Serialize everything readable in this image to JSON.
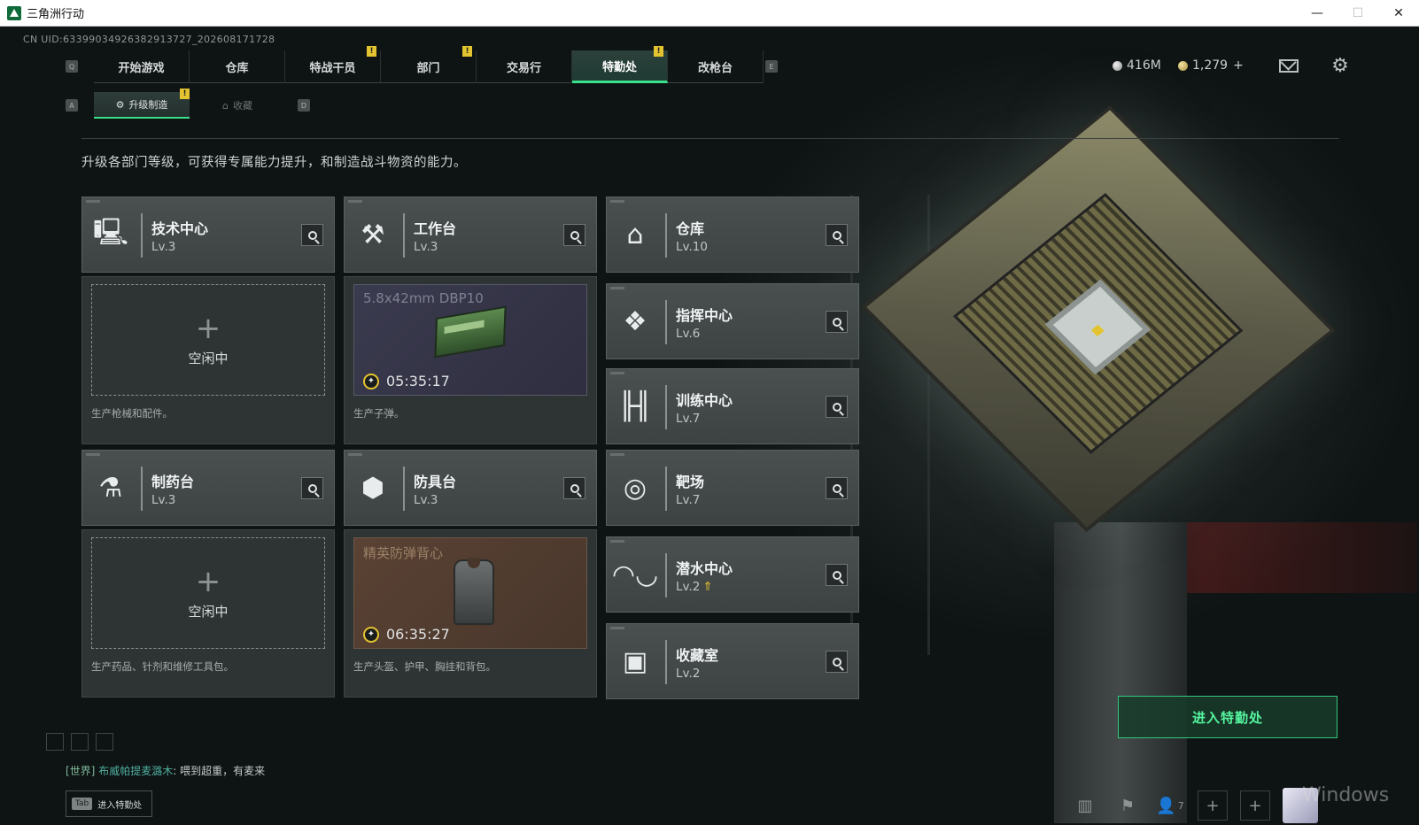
{
  "window": {
    "title": "三角洲行动",
    "minimize": "—",
    "maximize": "☐",
    "close": "✕"
  },
  "uid": "CN UID:6339903492638291372​7_202608171728",
  "nav": {
    "key_left": "Q",
    "key_right": "E",
    "tabs": [
      {
        "label": "开始游戏",
        "badge": ""
      },
      {
        "label": "仓库",
        "badge": ""
      },
      {
        "label": "特战干员",
        "badge": "!"
      },
      {
        "label": "部门",
        "badge": "!"
      },
      {
        "label": "交易行",
        "badge": ""
      },
      {
        "label": "特勤处",
        "badge": "!"
      },
      {
        "label": "改枪台",
        "badge": ""
      }
    ],
    "active_tab": "特勤处"
  },
  "currency": {
    "silver": "416M",
    "gold": "1,279",
    "gold_add": "+"
  },
  "subtabs": {
    "key_left": "A",
    "key_right": "D",
    "items": [
      {
        "label": "升级制造",
        "badge": "!"
      },
      {
        "label": "收藏",
        "badge": ""
      }
    ]
  },
  "description": "升级各部门等级，可获得专属能力提升，和制造战斗物资的能力。",
  "departments": {
    "tech": {
      "name": "技术中心",
      "level": "Lv.3"
    },
    "workbench": {
      "name": "工作台",
      "level": "Lv.3"
    },
    "warehouse": {
      "name": "仓库",
      "level": "Lv.10"
    },
    "command": {
      "name": "指挥中心",
      "level": "Lv.6"
    },
    "training": {
      "name": "训练中心",
      "level": "Lv.7"
    },
    "pharmacy": {
      "name": "制药台",
      "level": "Lv.3"
    },
    "armor": {
      "name": "防具台",
      "level": "Lv.3"
    },
    "range": {
      "name": "靶场",
      "level": "Lv.7"
    },
    "diving": {
      "name": "潜水中心",
      "level": "Lv.2"
    },
    "collection": {
      "name": "收藏室",
      "level": "Lv.2"
    }
  },
  "production": {
    "tech": {
      "status": "空闲中",
      "plus": "+",
      "desc": "生产枪械和配件。"
    },
    "workbench": {
      "item": "5.8x42mm DBP10",
      "timer": "05:35:17",
      "desc": "生产子弹。"
    },
    "pharmacy": {
      "status": "空闲中",
      "plus": "+",
      "desc": "生产药品、针剂和维修工具包。"
    },
    "armor": {
      "item": "精英防弹背心",
      "timer": "06:35:27",
      "desc": "生产头盔、护甲、胸挂和背包。"
    }
  },
  "enter_button": "进入特勤处",
  "chat": {
    "channel": "[世界]",
    "user": "布威帕提麦潞木",
    "message": "喂到超重，有麦来"
  },
  "tab_hint": {
    "key": "Tab",
    "label": "进入特勤处"
  },
  "friends": {
    "count": "7"
  },
  "watermark": "Windows"
}
